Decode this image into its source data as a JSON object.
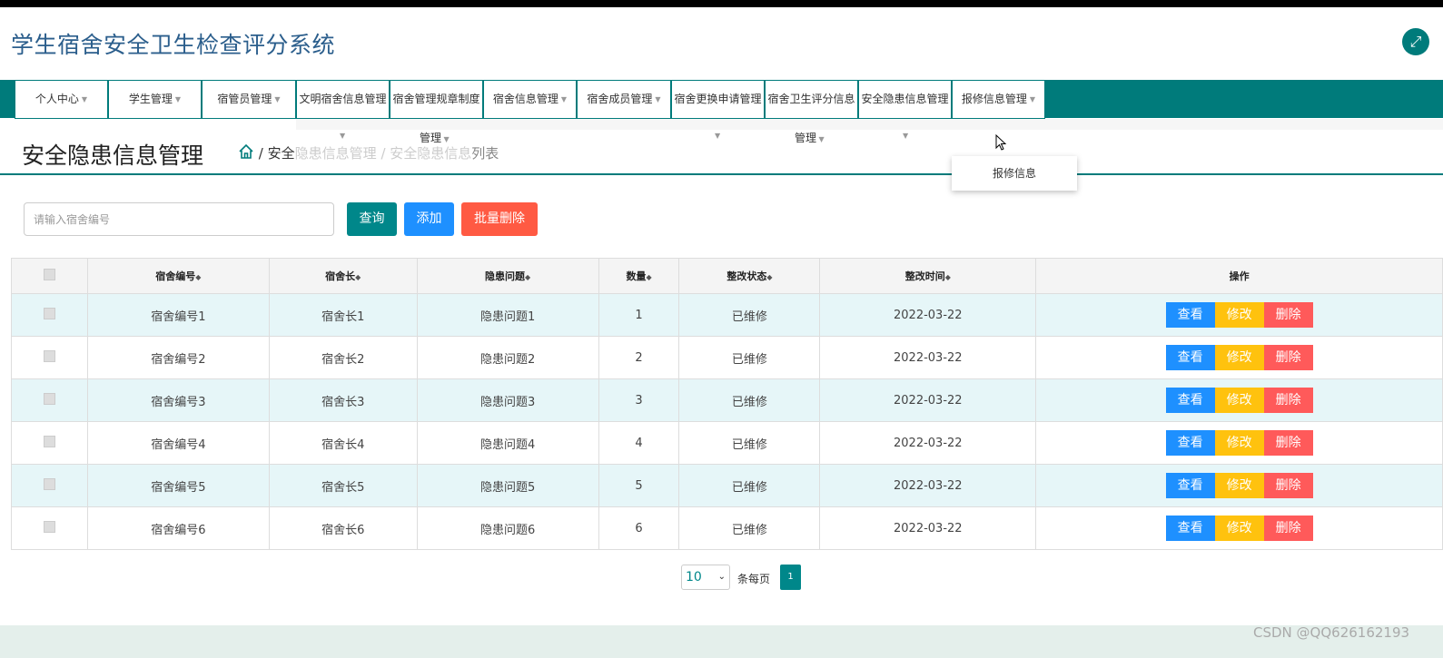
{
  "app": {
    "title": "学生宿舍安全卫生检查评分系统"
  },
  "nav": {
    "items": [
      {
        "label": "个人中心"
      },
      {
        "label": "学生管理"
      },
      {
        "label": "宿管员管理"
      },
      {
        "label": "文明宿舍信息管理"
      },
      {
        "label": "宿舍管理规章制度"
      },
      {
        "label": "宿舍信息管理"
      },
      {
        "label": "宿舍成员管理"
      },
      {
        "label": "宿舍更换申请管理"
      },
      {
        "label": "宿舍卫生评分信息"
      },
      {
        "label": "安全隐患信息管理"
      },
      {
        "label": "报修信息管理"
      }
    ],
    "sub_labels": {
      "rules": "管理",
      "score": "管理"
    },
    "open_dropdown": {
      "items": [
        "报修信息"
      ]
    }
  },
  "page": {
    "title": "安全隐患信息管理",
    "breadcrumb": {
      "sep": "/",
      "level1_visible": "安全",
      "level1_faded": "隐患信息管理",
      "sep2": "/",
      "level2_faded": "安全隐患信息",
      "level2_visible": "列表"
    }
  },
  "search": {
    "placeholder": "请输入宿舍编号",
    "query_label": "查询",
    "add_label": "添加",
    "batch_delete_label": "批量删除"
  },
  "table": {
    "columns": [
      "宿舍编号",
      "宿舍长",
      "隐患问题",
      "数量",
      "整改状态",
      "整改时间",
      "操作"
    ],
    "rows": [
      {
        "dorm_no": "宿舍编号1",
        "leader": "宿舍长1",
        "issue": "隐患问题1",
        "count": "1",
        "status": "已维修",
        "time": "2022-03-22"
      },
      {
        "dorm_no": "宿舍编号2",
        "leader": "宿舍长2",
        "issue": "隐患问题2",
        "count": "2",
        "status": "已维修",
        "time": "2022-03-22"
      },
      {
        "dorm_no": "宿舍编号3",
        "leader": "宿舍长3",
        "issue": "隐患问题3",
        "count": "3",
        "status": "已维修",
        "time": "2022-03-22"
      },
      {
        "dorm_no": "宿舍编号4",
        "leader": "宿舍长4",
        "issue": "隐患问题4",
        "count": "4",
        "status": "已维修",
        "time": "2022-03-22"
      },
      {
        "dorm_no": "宿舍编号5",
        "leader": "宿舍长5",
        "issue": "隐患问题5",
        "count": "5",
        "status": "已维修",
        "time": "2022-03-22"
      },
      {
        "dorm_no": "宿舍编号6",
        "leader": "宿舍长6",
        "issue": "隐患问题6",
        "count": "6",
        "status": "已维修",
        "time": "2022-03-22"
      }
    ],
    "actions": {
      "view": "查看",
      "edit": "修改",
      "delete": "删除"
    }
  },
  "pagination": {
    "page_size": "10",
    "per_page_label": "条每页",
    "current_page": "1"
  },
  "watermark": "CSDN @QQ626162193",
  "colors": {
    "primary": "#007b7b",
    "view": "#1e90ff",
    "edit": "#ffc20e",
    "delete": "#ff5a5a"
  }
}
